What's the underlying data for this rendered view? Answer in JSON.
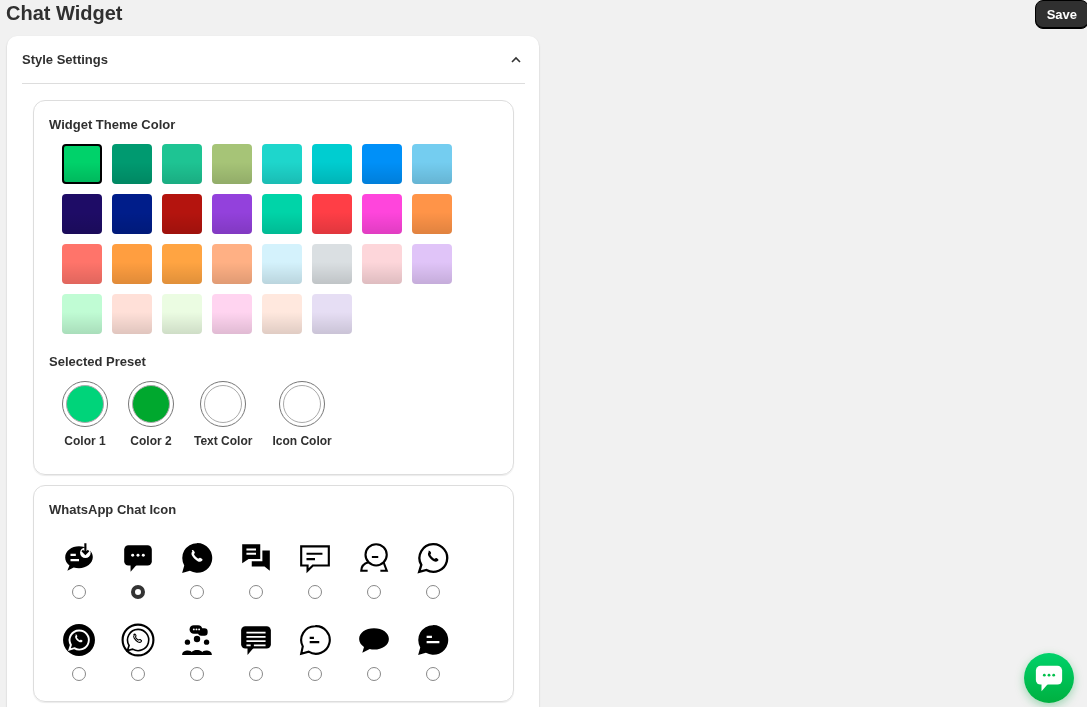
{
  "page_title": "Chat Widget",
  "save_button": "Save",
  "section": {
    "title": "Style Settings",
    "expanded": true
  },
  "theme": {
    "title": "Widget Theme Color",
    "swatches": [
      {
        "color": "#00d26a",
        "selected": true
      },
      {
        "color": "#009a70",
        "selected": false
      },
      {
        "color": "#1ec493",
        "selected": false
      },
      {
        "color": "#a6c477",
        "selected": false
      },
      {
        "color": "#1ed6cc",
        "selected": false
      },
      {
        "color": "#00cdd0",
        "selected": false
      },
      {
        "color": "#0090f8",
        "selected": false
      },
      {
        "color": "#74cdf0",
        "selected": false
      },
      {
        "color": "#1e0c66",
        "selected": false
      },
      {
        "color": "#001d8a",
        "selected": false
      },
      {
        "color": "#b4140e",
        "selected": false
      },
      {
        "color": "#9341dc",
        "selected": false
      },
      {
        "color": "#00d4a8",
        "selected": false
      },
      {
        "color": "#ff3e46",
        "selected": false
      },
      {
        "color": "#ff45dc",
        "selected": false
      },
      {
        "color": "#ff9448",
        "selected": false
      },
      {
        "color": "#ff746a",
        "selected": false
      },
      {
        "color": "#ff9e40",
        "selected": false
      },
      {
        "color": "#ffa442",
        "selected": false
      },
      {
        "color": "#ffb084",
        "selected": false
      },
      {
        "color": "#d4f2fc",
        "selected": false
      },
      {
        "color": "#dadfe2",
        "selected": false
      },
      {
        "color": "#fdd6da",
        "selected": false
      },
      {
        "color": "#e0c4f8",
        "selected": false
      },
      {
        "color": "#c0fcd4",
        "selected": false
      },
      {
        "color": "#ffe0d8",
        "selected": false
      },
      {
        "color": "#ebfce2",
        "selected": false
      },
      {
        "color": "#ffd4f0",
        "selected": false
      },
      {
        "color": "#ffe8de",
        "selected": false
      },
      {
        "color": "#e6def4",
        "selected": false
      }
    ]
  },
  "preset": {
    "title": "Selected Preset",
    "colors": [
      {
        "label": "Color 1",
        "color": "#00d47a"
      },
      {
        "label": "Color 2",
        "color": "#00a82e"
      },
      {
        "label": "Text Color",
        "color": "#ffffff"
      },
      {
        "label": "Icon Color",
        "color": "#ffffff"
      }
    ]
  },
  "chat_icon": {
    "title": "WhatsApp Chat Icon",
    "icons": [
      {
        "kind": "bubble-download",
        "selected": false
      },
      {
        "kind": "bubble-dots",
        "selected": true
      },
      {
        "kind": "phone-bubble",
        "selected": false
      },
      {
        "kind": "two-bubbles",
        "selected": false
      },
      {
        "kind": "lines-bubble-outline",
        "selected": false
      },
      {
        "kind": "two-bubbles-outline",
        "selected": false
      },
      {
        "kind": "phone-bubble-outline",
        "selected": false
      },
      {
        "kind": "phone-circle",
        "selected": false
      },
      {
        "kind": "phone-circle-outline",
        "selected": false
      },
      {
        "kind": "group-chat",
        "selected": false
      },
      {
        "kind": "text-bubble",
        "selected": false
      },
      {
        "kind": "dash-bubble-outline",
        "selected": false
      },
      {
        "kind": "oval-bubble",
        "selected": false
      },
      {
        "kind": "dash-bubble",
        "selected": false
      }
    ]
  }
}
